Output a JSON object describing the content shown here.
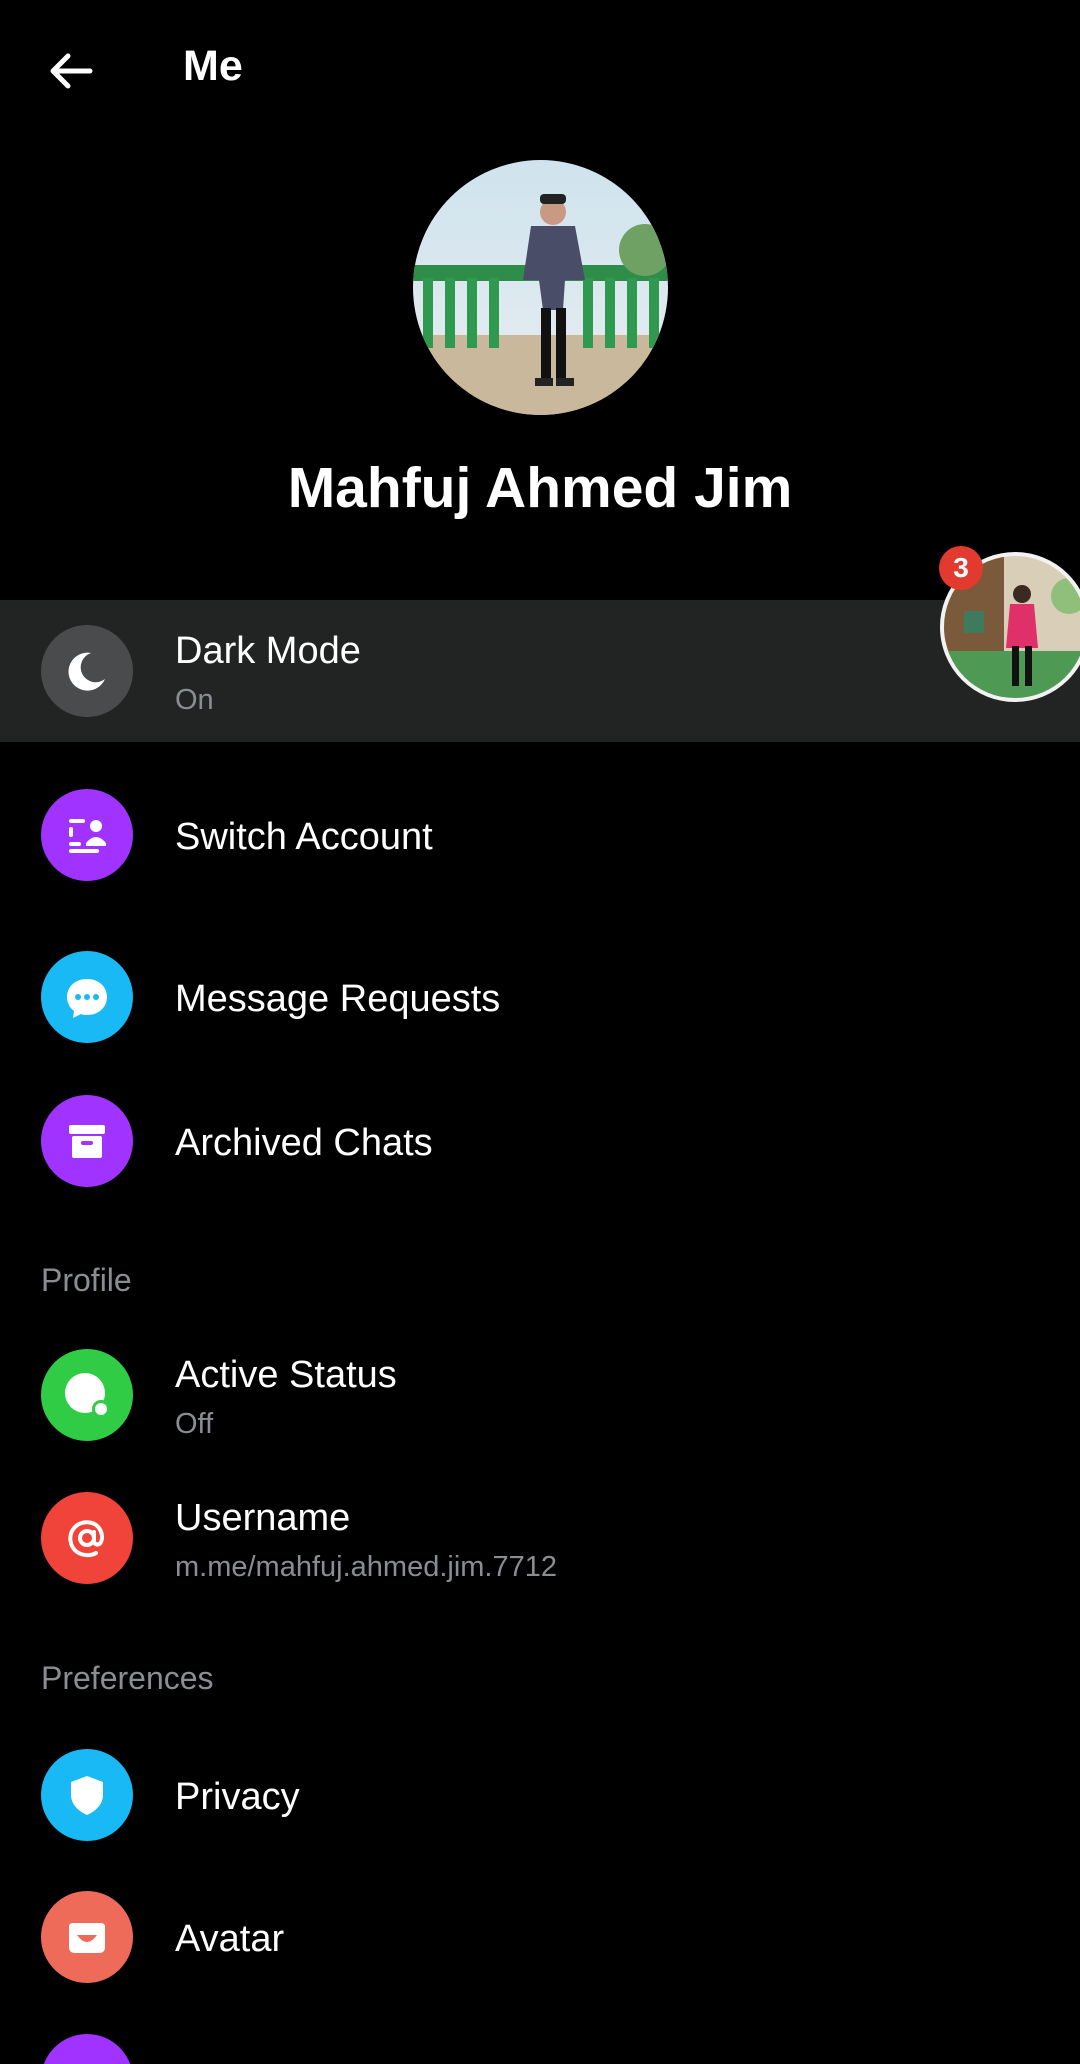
{
  "header": {
    "title": "Me",
    "back_icon": "arrow-left-icon"
  },
  "profile": {
    "name": "Mahfuj Ahmed Jim"
  },
  "chathead": {
    "badge_count": "3"
  },
  "menu": {
    "dark_mode": {
      "label": "Dark Mode",
      "sub": "On",
      "icon": "moon-icon",
      "color": "#4a4b4d"
    },
    "switch_account": {
      "label": "Switch Account",
      "icon": "switch-account-icon",
      "color": "#a033ff"
    },
    "message_requests": {
      "label": "Message Requests",
      "icon": "chat-bubble-icon",
      "color": "#18b9f5"
    },
    "archived_chats": {
      "label": "Archived Chats",
      "icon": "archive-box-icon",
      "color": "#a033ff"
    }
  },
  "sections": {
    "profile": "Profile",
    "preferences": "Preferences"
  },
  "profile_items": {
    "active_status": {
      "label": "Active Status",
      "sub": "Off",
      "icon": "active-status-icon",
      "color": "#31cc46"
    },
    "username": {
      "label": "Username",
      "sub": "m.me/mahfuj.ahmed.jim.7712",
      "icon": "at-sign-icon",
      "color": "#f0433a"
    }
  },
  "preference_items": {
    "privacy": {
      "label": "Privacy",
      "icon": "shield-icon",
      "color": "#18b9f5"
    },
    "avatar": {
      "label": "Avatar",
      "icon": "avatar-face-icon",
      "color": "#ee6b5a"
    }
  }
}
